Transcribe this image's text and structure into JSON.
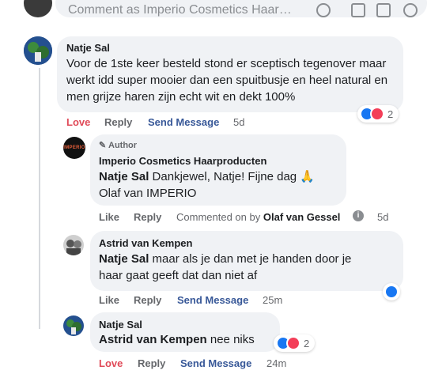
{
  "composer": {
    "placeholder": "Comment as Imperio Cosmetics Haar…"
  },
  "comments": [
    {
      "author": "Natje Sal",
      "text": "Voor de 1ste keer besteld stond er sceptisch tegenover maar werkt idd super mooier dan een spuitbusje en heel natural en men grijze haren zijn echt wit en dekt 100%",
      "actions": {
        "love": "Love",
        "reply": "Reply",
        "send": "Send Message"
      },
      "time": "5d",
      "reaction_count": "2"
    },
    {
      "badge": "Author",
      "author": "Imperio Cosmetics Haarproducten",
      "logo_text": "IMPERIO",
      "mention": "Natje Sal",
      "text_line1": "Dankjewel, Natje! Fijne dag 🙏",
      "text_line2": "Olaf van IMPERIO",
      "actions": {
        "like": "Like",
        "reply": "Reply",
        "commented_prefix": "Commented on by",
        "commented_by": "Olaf van Gessel"
      },
      "time": "5d"
    },
    {
      "author": "Astrid van Kempen",
      "mention": "Natje Sal",
      "text_line1": "maar als je dan met je handen door je",
      "text_line2": "haar gaat geeft dat dan niet af",
      "actions": {
        "like": "Like",
        "reply": "Reply",
        "send": "Send Message"
      },
      "time": "25m"
    },
    {
      "author": "Natje Sal",
      "mention": "Astrid van Kempen",
      "text": "nee niks",
      "actions": {
        "love": "Love",
        "reply": "Reply",
        "send": "Send Message"
      },
      "time": "24m",
      "reaction_count": "2"
    }
  ],
  "colors": {
    "love": "#e04a58",
    "link": "#385898",
    "like_blue": "#1877f2",
    "heart_red": "#f33e58",
    "bubble": "#f0f2f5"
  }
}
